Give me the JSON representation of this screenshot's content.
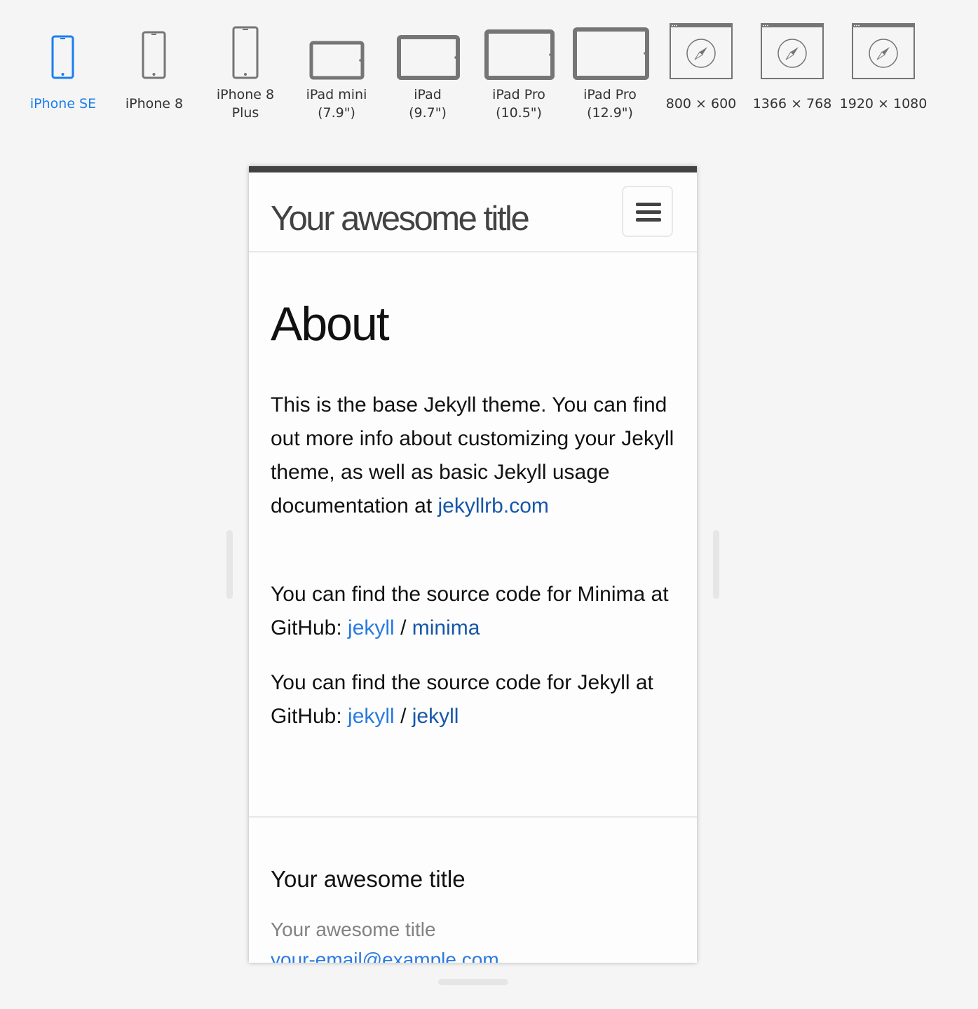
{
  "devices": [
    {
      "name": "iPhone SE",
      "selected": true
    },
    {
      "name": "iPhone 8",
      "selected": false
    },
    {
      "name": "iPhone 8\nPlus",
      "selected": false
    },
    {
      "name": "iPad mini\n(7.9\")",
      "selected": false
    },
    {
      "name": "iPad\n(9.7\")",
      "selected": false
    },
    {
      "name": "iPad Pro\n(10.5\")",
      "selected": false
    },
    {
      "name": "iPad Pro\n(12.9\")",
      "selected": false
    },
    {
      "name": "800 × 600",
      "selected": false
    },
    {
      "name": "1366 × 768",
      "selected": false
    },
    {
      "name": "1920 × 1080",
      "selected": false
    }
  ],
  "colors": {
    "selected": "#1a7ef0",
    "icon_gray": "#757575",
    "link": "#2a7ae2",
    "link_visited": "#1756a9",
    "header_accent": "#424242"
  },
  "site": {
    "title": "Your awesome title",
    "menu_icon": "hamburger-icon"
  },
  "page": {
    "heading": "About",
    "para1_text": "This is the base Jekyll theme. You can find out more info about customizing your Jekyll theme, as well as basic Jekyll usage documentation at ",
    "para1_link": "jekyllrb.com",
    "para2_text": "You can find the source code for Minima at GitHub: ",
    "para2_link_user": "jekyll",
    "para2_sep": " / ",
    "para2_link_repo": "minima",
    "para3_text": "You can find the source code for Jekyll at GitHub: ",
    "para3_link_user": "jekyll",
    "para3_sep": " / ",
    "para3_link_repo": "jekyll"
  },
  "footer": {
    "heading": "Your awesome title",
    "name": "Your awesome title",
    "email": "your-email@example.com"
  }
}
